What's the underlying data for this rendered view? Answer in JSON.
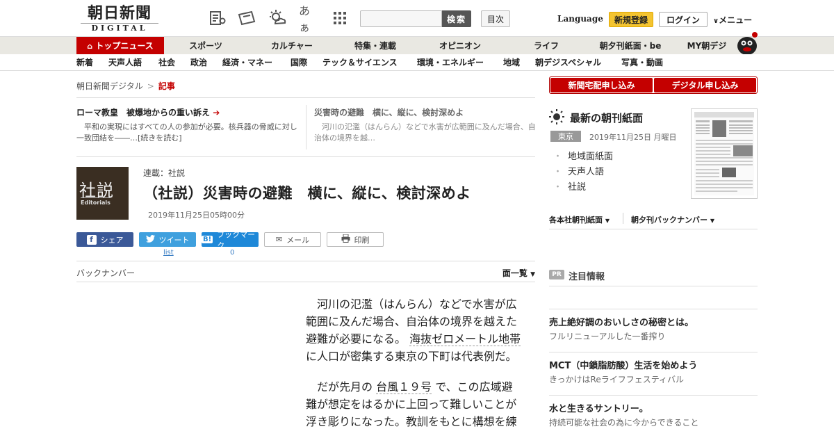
{
  "header": {
    "logo_jp": "朝日新聞",
    "logo_en": "DIGITAL",
    "font_size_icon": "あぁ",
    "search_button": "検索",
    "search_placeholder": "",
    "toc_button": "目次",
    "language": "Language",
    "register": "新規登録",
    "login": "ログイン",
    "menu": "メニュー"
  },
  "main_nav": [
    {
      "label": "トップニュース",
      "active": true
    },
    {
      "label": "スポーツ"
    },
    {
      "label": "カルチャー"
    },
    {
      "label": "特集・連載"
    },
    {
      "label": "オピニオン"
    },
    {
      "label": "ライフ"
    },
    {
      "label": "朝夕刊紙面・be"
    },
    {
      "label": "MY朝デジ"
    }
  ],
  "sub_nav": [
    "新着",
    "天声人語",
    "社会",
    "政治",
    "経済・マネー",
    "国際",
    "テック＆サイエンス",
    "環境・エネルギー",
    "地域",
    "朝デジスペシャル",
    "写真・動画"
  ],
  "breadcrumb": {
    "home": "朝日新聞デジタル",
    "sep": ">",
    "current": "記事"
  },
  "pickups": [
    {
      "title": "ローマ教皇　被爆地からの重い訴え",
      "text": "平和の実現にはすべての人の参加が必要。核兵器の脅威に対し一致団結を――…[続きを読む]"
    },
    {
      "title": "災害時の避難　横に、縦に、検討深めよ",
      "text": "河川の氾濫（はんらん）などで水害が広範囲に及んだ場合、自治体の境界を越…"
    }
  ],
  "article": {
    "thumb_big": "社説",
    "thumb_small": "Editorials",
    "series": "連載：社説",
    "title": "（社説）災害時の避難　横に、縦に、検討深めよ",
    "date": "2019年11月25日05時00分",
    "paragraphs": {
      "p1_a": "河川の氾濫（はんらん）などで水害が広範囲に及んだ場合、自治体の境界を越えた避難が必要になる。",
      "p1_kw": "海抜ゼロメートル地帯",
      "p1_b": "に人口が密集する東京の下町は代表例だ。",
      "p2_a": "だが先月の",
      "p2_kw": "台風１９号",
      "p2_b": "で、この広域避難が想定をはるかに上回って難しいことが浮き彫りになった。教訓をもとに構想を練"
    }
  },
  "share": {
    "facebook": "シェア",
    "twitter": "ツイート",
    "twitter_count": "list",
    "hatena": "ブックマーク",
    "hatena_count": "0",
    "mail": "メール",
    "print": "印刷"
  },
  "backnumber": {
    "label": "バックナンバー",
    "menu": "面一覧"
  },
  "sidebar": {
    "subscribe_paper": "新聞宅配申し込み",
    "subscribe_digital": "デジタル申し込み",
    "latest_title": "最新の朝刊紙面",
    "region": "東京",
    "paper_date": "2019年11月25日 月曜日",
    "paper_links": [
      "地域面紙面",
      "天声人語",
      "社説"
    ],
    "edition_a": "各本社朝刊紙面",
    "edition_b": "朝夕刊バックナンバー",
    "pr_badge": "PR",
    "pr_title": "注目情報",
    "pr_items": [
      {
        "title": "売上絶好調のおいしさの秘密とは。",
        "sub": "フルリニューアルした一番搾り"
      },
      {
        "title": "MCT（中鎖脂肪酸）生活を始めよう",
        "sub": "きっかけはReライフフェスティバル"
      },
      {
        "title": "水と生きるサントリー。",
        "sub": "持続可能な社会の為に今からできること"
      }
    ]
  },
  "colors": {
    "brand_red": "#c40000",
    "register_yellow": "#f4c430",
    "facebook": "#3b5998",
    "twitter": "#3fa0de",
    "hatena": "#1e88d8"
  }
}
